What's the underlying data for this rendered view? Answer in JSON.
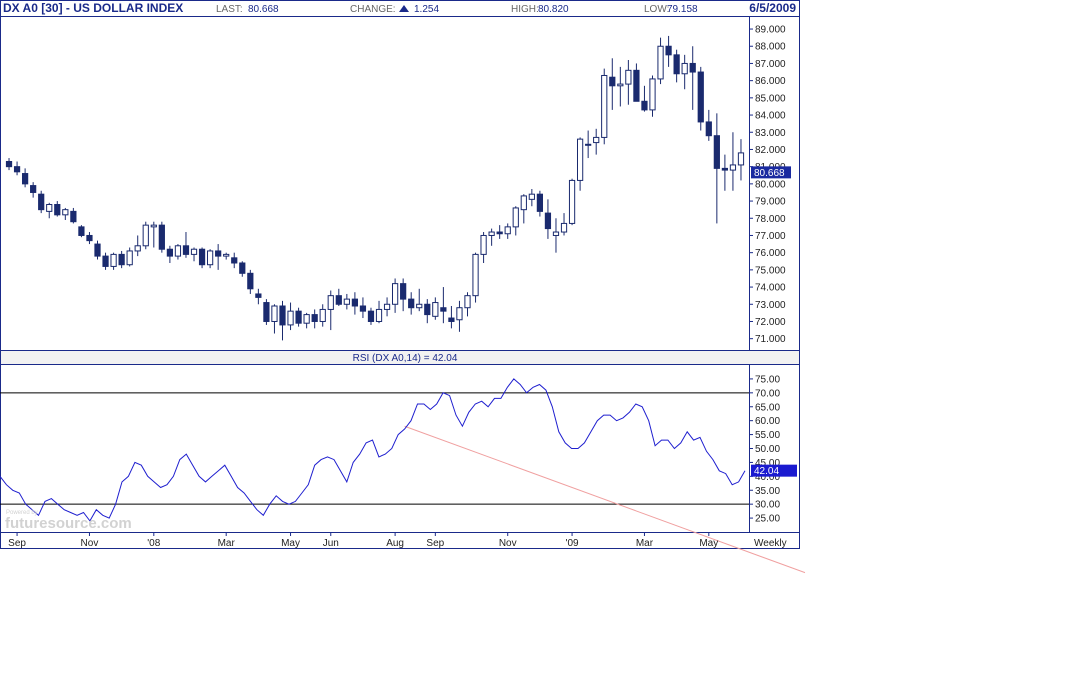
{
  "header": {
    "symbol": "DX A0 [30] - US DOLLAR INDEX",
    "last_label": "LAST:",
    "last_value": "80.668",
    "change_label": "CHANGE:",
    "change_value": "1.254",
    "high_label": "HIGH:",
    "high_value": "80.820",
    "low_label": "LOW:",
    "low_value": "79.158",
    "date": "6/5/2009"
  },
  "watermark": {
    "text": "futuresource.com",
    "small": "Powered by"
  },
  "period_label": "Weekly",
  "colors": {
    "frame": "#1a2a8a",
    "up_body": "#ffffff",
    "down_body": "#1a2a6e",
    "candle_wick": "#1a2a6e",
    "rsi_line": "#1f1fcf",
    "trendline": "#f0a0a0",
    "price_tag_bg": "#1a2aa0",
    "rsi_tag_bg": "#1a1ad0"
  },
  "chart_data": [
    {
      "type": "candlestick",
      "title": "DX A0 [30] - US DOLLAR INDEX",
      "frequency": "weekly",
      "ylim": [
        70.4,
        89.7
      ],
      "y_ticks": [
        "71.000",
        "72.000",
        "73.000",
        "74.000",
        "75.000",
        "76.000",
        "77.000",
        "78.000",
        "79.000",
        "80.000",
        "81.000",
        "82.000",
        "83.000",
        "84.000",
        "85.000",
        "86.000",
        "87.000",
        "88.000",
        "89.000"
      ],
      "last_tag": "80.668",
      "x_labels": [
        {
          "label": "Sep",
          "index": 1
        },
        {
          "label": "Nov",
          "index": 10
        },
        {
          "label": "'08",
          "index": 18
        },
        {
          "label": "Mar",
          "index": 27
        },
        {
          "label": "May",
          "index": 35
        },
        {
          "label": "Jun",
          "index": 40
        },
        {
          "label": "Aug",
          "index": 48
        },
        {
          "label": "Sep",
          "index": 53
        },
        {
          "label": "Nov",
          "index": 62
        },
        {
          "label": "'09",
          "index": 70
        },
        {
          "label": "Mar",
          "index": 79
        },
        {
          "label": "May",
          "index": 87
        }
      ],
      "ohlc": [
        [
          81.3,
          81.5,
          80.8,
          81.0
        ],
        [
          81.0,
          81.3,
          80.5,
          80.7
        ],
        [
          80.6,
          80.9,
          79.8,
          80.0
        ],
        [
          79.9,
          80.1,
          79.2,
          79.5
        ],
        [
          79.4,
          79.6,
          78.3,
          78.5
        ],
        [
          78.4,
          78.9,
          78.0,
          78.8
        ],
        [
          78.8,
          79.0,
          78.1,
          78.2
        ],
        [
          78.2,
          78.6,
          77.9,
          78.5
        ],
        [
          78.4,
          78.6,
          77.7,
          77.8
        ],
        [
          77.5,
          77.6,
          76.9,
          77.0
        ],
        [
          77.0,
          77.2,
          76.5,
          76.7
        ],
        [
          76.5,
          76.7,
          75.6,
          75.8
        ],
        [
          75.8,
          76.0,
          75.0,
          75.2
        ],
        [
          75.2,
          76.0,
          75.0,
          75.9
        ],
        [
          75.9,
          76.1,
          75.1,
          75.3
        ],
        [
          75.3,
          76.3,
          75.2,
          76.1
        ],
        [
          76.1,
          77.0,
          75.8,
          76.4
        ],
        [
          76.4,
          77.8,
          76.2,
          77.6
        ],
        [
          77.5,
          77.8,
          76.3,
          77.6
        ],
        [
          77.6,
          77.8,
          76.0,
          76.2
        ],
        [
          76.2,
          76.4,
          75.4,
          75.8
        ],
        [
          75.8,
          76.5,
          75.6,
          76.4
        ],
        [
          76.4,
          77.2,
          75.7,
          75.9
        ],
        [
          75.9,
          76.3,
          75.5,
          76.2
        ],
        [
          76.2,
          76.3,
          75.1,
          75.3
        ],
        [
          75.3,
          76.2,
          75.1,
          76.1
        ],
        [
          76.1,
          76.5,
          75.0,
          75.8
        ],
        [
          75.8,
          76.0,
          75.6,
          75.9
        ],
        [
          75.7,
          76.0,
          75.1,
          75.4
        ],
        [
          75.4,
          75.5,
          74.6,
          74.8
        ],
        [
          74.8,
          75.0,
          73.6,
          73.9
        ],
        [
          73.6,
          73.9,
          73.0,
          73.4
        ],
        [
          73.1,
          73.3,
          71.8,
          72.0
        ],
        [
          72.0,
          73.0,
          71.3,
          72.9
        ],
        [
          72.9,
          73.2,
          70.9,
          71.8
        ],
        [
          71.8,
          73.1,
          71.5,
          72.6
        ],
        [
          72.6,
          72.8,
          71.7,
          71.9
        ],
        [
          71.9,
          72.5,
          71.6,
          72.4
        ],
        [
          72.4,
          72.7,
          71.6,
          72.0
        ],
        [
          72.0,
          73.0,
          71.7,
          72.7
        ],
        [
          72.7,
          73.8,
          71.5,
          73.5
        ],
        [
          73.5,
          73.9,
          72.9,
          73.0
        ],
        [
          73.0,
          73.6,
          72.7,
          73.3
        ],
        [
          73.3,
          73.7,
          72.4,
          72.9
        ],
        [
          72.9,
          73.4,
          72.2,
          72.6
        ],
        [
          72.6,
          72.8,
          71.8,
          72.0
        ],
        [
          72.0,
          73.2,
          71.9,
          72.7
        ],
        [
          72.7,
          73.4,
          72.3,
          73.0
        ],
        [
          73.0,
          74.5,
          72.5,
          74.2
        ],
        [
          74.2,
          74.5,
          72.6,
          73.3
        ],
        [
          73.3,
          73.7,
          72.4,
          72.8
        ],
        [
          72.8,
          73.9,
          72.6,
          73.0
        ],
        [
          73.0,
          73.3,
          71.9,
          72.4
        ],
        [
          72.3,
          73.4,
          72.1,
          73.1
        ],
        [
          72.8,
          74.0,
          71.9,
          72.6
        ],
        [
          72.2,
          72.9,
          71.6,
          72.0
        ],
        [
          72.1,
          73.2,
          71.4,
          72.8
        ],
        [
          72.8,
          73.7,
          72.3,
          73.5
        ],
        [
          73.5,
          76.0,
          73.1,
          75.9
        ],
        [
          75.9,
          77.2,
          75.4,
          77.0
        ],
        [
          77.0,
          77.4,
          76.4,
          77.2
        ],
        [
          77.2,
          77.6,
          76.8,
          77.1
        ],
        [
          77.1,
          77.7,
          76.8,
          77.5
        ],
        [
          77.5,
          78.7,
          77.0,
          78.6
        ],
        [
          78.5,
          79.4,
          77.7,
          79.3
        ],
        [
          79.1,
          79.7,
          78.7,
          79.4
        ],
        [
          79.4,
          79.6,
          78.1,
          78.4
        ],
        [
          78.3,
          79.1,
          76.8,
          77.4
        ],
        [
          77.0,
          78.0,
          76.0,
          77.2
        ],
        [
          77.2,
          78.3,
          77.0,
          77.7
        ],
        [
          77.7,
          80.3,
          77.6,
          80.2
        ],
        [
          80.2,
          82.7,
          79.6,
          82.6
        ],
        [
          82.3,
          83.1,
          81.5,
          82.3
        ],
        [
          82.4,
          83.2,
          81.7,
          82.7
        ],
        [
          82.7,
          86.7,
          82.3,
          86.3
        ],
        [
          86.2,
          87.3,
          84.3,
          85.7
        ],
        [
          85.7,
          86.8,
          84.5,
          85.8
        ],
        [
          85.8,
          87.2,
          84.6,
          86.6
        ],
        [
          86.6,
          87.0,
          84.9,
          84.8
        ],
        [
          84.8,
          85.7,
          84.2,
          84.3
        ],
        [
          84.3,
          86.3,
          83.9,
          86.1
        ],
        [
          86.1,
          88.5,
          85.8,
          88.0
        ],
        [
          88.0,
          88.6,
          86.8,
          87.5
        ],
        [
          87.5,
          87.8,
          85.9,
          86.4
        ],
        [
          86.4,
          87.5,
          85.5,
          87.0
        ],
        [
          87.0,
          88.0,
          84.3,
          86.5
        ],
        [
          86.5,
          86.8,
          83.1,
          83.6
        ],
        [
          83.6,
          84.3,
          82.5,
          82.8
        ],
        [
          82.8,
          84.1,
          77.7,
          80.9
        ],
        [
          80.9,
          81.7,
          79.6,
          80.8
        ],
        [
          80.8,
          83.0,
          79.6,
          81.1
        ],
        [
          81.1,
          82.6,
          80.2,
          81.8
        ]
      ]
    },
    {
      "type": "line",
      "title": "RSI (DX A0,14) = 42.04",
      "series": [
        {
          "name": "RSI (DX A0,14)",
          "values": [
            40,
            37,
            35,
            34,
            30,
            28,
            26,
            31,
            32,
            30,
            28,
            27,
            26,
            27,
            24,
            28,
            26,
            25,
            30,
            38,
            40,
            45,
            44,
            40,
            38,
            36,
            37,
            40,
            46,
            48,
            44,
            40,
            38,
            40,
            42,
            44,
            40,
            36,
            34,
            31,
            28,
            26,
            30,
            33,
            31,
            30,
            31,
            34,
            37,
            44,
            46,
            47,
            46,
            42,
            38,
            45,
            48,
            52,
            53,
            47,
            48,
            50,
            55,
            57,
            60,
            66,
            66,
            64,
            66,
            70,
            69,
            62,
            58,
            63,
            66,
            67,
            65,
            68,
            68,
            72,
            75,
            73,
            70,
            72,
            73,
            71,
            65,
            56,
            52,
            50,
            50,
            52,
            56,
            60,
            62,
            62,
            60,
            61,
            63,
            66,
            65,
            60,
            51,
            53,
            53,
            50,
            52,
            56,
            53,
            54,
            49,
            46,
            42,
            41,
            37,
            38,
            42
          ]
        }
      ],
      "ylim": [
        20,
        80
      ],
      "y_ticks": [
        "25.00",
        "30.00",
        "35.00",
        "40.00",
        "45.00",
        "50.00",
        "55.00",
        "60.00",
        "65.00",
        "70.00",
        "75.00"
      ],
      "reference_lines": [
        30,
        70
      ],
      "trendline": {
        "from": [
          63,
          58
        ],
        "to": [
          95,
          31
        ]
      },
      "last_tag": "42.04",
      "x_labels": [
        "Sep",
        "Nov",
        "'08",
        "Mar",
        "May",
        "Jun",
        "Aug",
        "Sep",
        "Nov",
        "'09",
        "Mar",
        "May",
        "Weekly"
      ]
    }
  ]
}
